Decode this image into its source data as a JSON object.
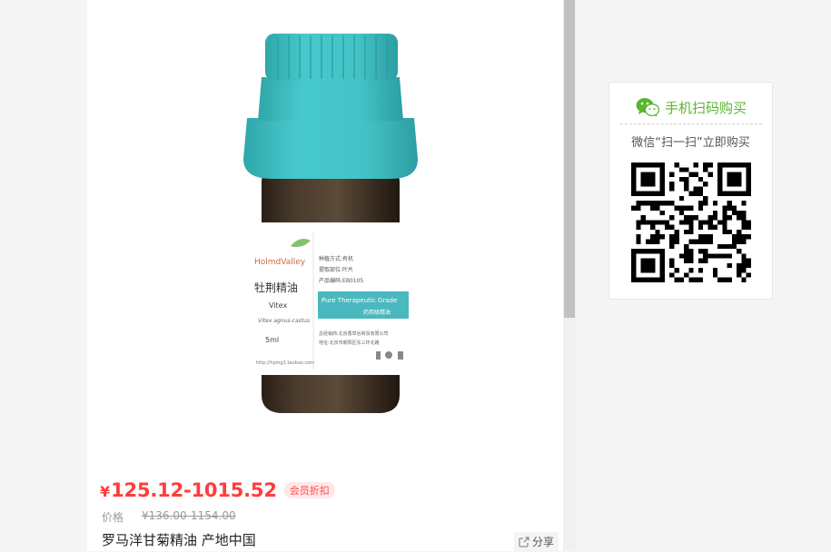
{
  "product": {
    "currency": "¥",
    "price_range": "125.12-1015.52",
    "member_badge": "会员折扣",
    "original_price_label": "价格",
    "original_price": "¥136.00-1154.00",
    "title": "罗马洋甘菊精油 产地中国",
    "share_label": "分享",
    "bottle_label": {
      "brand": "HolmdValley",
      "name_cn": "牡荆精油",
      "name_en": "Vitex",
      "latin": "Vitex agnus-castus",
      "volume": "5ml",
      "info_line1": "种植方式:有机",
      "info_line2": "提取部位:叶片",
      "info_line3": "产品编码:EB0105",
      "band_text": "Pure Therapeutic Grade",
      "band_sub": "药用级精油",
      "footer1": "总经销商:北京香草谷商贸有限公司",
      "footer2": "地址:北京市朝阳区东三环北路",
      "website": "http://hpmg1.taobao.com"
    }
  },
  "qr_panel": {
    "heading": "手机扫码购买",
    "instruction": "微信“扫一扫”立即购买"
  },
  "colors": {
    "price": "#ff3c3c",
    "wechat_green": "#5bb42f",
    "cap_teal": "#3fc1c4"
  },
  "icons": {
    "share": "share-icon",
    "wechat": "wechat-icon",
    "qr": "qr-code-icon"
  }
}
